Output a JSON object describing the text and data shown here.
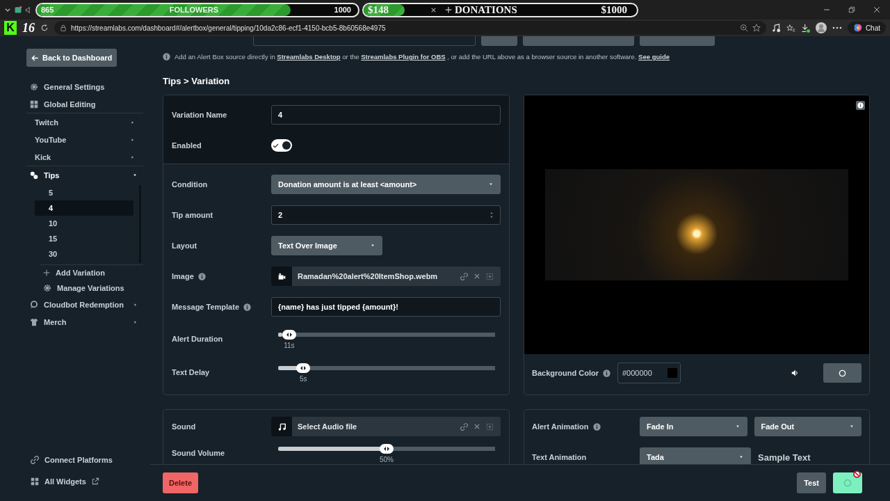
{
  "overlay": {
    "followers": {
      "current": "865",
      "label": "FOLLOWERS",
      "goal": "1000",
      "level": 0.79
    },
    "donations": {
      "current": "$148",
      "label": "DONATIONS",
      "goal": "$1000",
      "level": 0.15
    }
  },
  "browser": {
    "logo": "K",
    "badge": "16",
    "url": "https://streamlabs.com/dashboard#/alertbox/general/tipping/10da2c86-ecf1-4150-bcb5-8b60568e4975",
    "chat": "Chat"
  },
  "sidebar": {
    "back": "Back to Dashboard",
    "items": [
      {
        "kind": "nav",
        "label": "General Settings"
      },
      {
        "kind": "nav",
        "label": "Global Editing"
      },
      {
        "kind": "platform",
        "label": "Twitch",
        "expanded": false
      },
      {
        "kind": "platform",
        "label": "YouTube",
        "expanded": false
      },
      {
        "kind": "platform",
        "label": "Kick",
        "expanded": false
      },
      {
        "kind": "group",
        "label": "Tips",
        "expanded": true,
        "children": [
          {
            "label": "5",
            "selected": false
          },
          {
            "label": "4",
            "selected": true
          },
          {
            "label": "10",
            "selected": false
          },
          {
            "label": "15",
            "selected": false
          },
          {
            "label": "30",
            "selected": false
          }
        ],
        "actions": [
          "Add Variation",
          "Manage Variations"
        ]
      },
      {
        "kind": "group",
        "label": "Cloudbot Redemption",
        "expanded": false
      },
      {
        "kind": "group",
        "label": "Merch",
        "expanded": false
      }
    ],
    "footer_links": [
      {
        "label": "Connect Platforms",
        "external": false
      },
      {
        "label": "All Widgets",
        "external": true
      }
    ]
  },
  "info_line": [
    {
      "text": "Add an Alert Box source directly in",
      "link": false
    },
    {
      "text": "Streamlabs Desktop",
      "link": true
    },
    {
      "text": "or the",
      "link": false
    },
    {
      "text": "Streamlabs Plugin for OBS",
      "link": true
    },
    {
      "text": ", or add the URL above as a browser source in another software.",
      "link": false
    },
    {
      "text": "See guide",
      "link": true
    }
  ],
  "breadcrumb": "Tips > Variation",
  "variation_panel": {
    "header_rows": [
      {
        "kind": "text",
        "label": "Variation Name",
        "value": "4"
      },
      {
        "kind": "toggle",
        "label": "Enabled",
        "on": true
      }
    ],
    "rows": [
      {
        "kind": "select",
        "label": "Condition",
        "value": "Donation amount is at least <amount>"
      },
      {
        "kind": "number",
        "label": "Tip amount",
        "value": "2"
      },
      {
        "kind": "short-select",
        "label": "Layout",
        "value": "Text Over Image"
      },
      {
        "kind": "file",
        "label": "Image",
        "info": true,
        "value": "Ramadan%20alert%20ItemShop.webm"
      },
      {
        "kind": "text",
        "label": "Message Template",
        "info": true,
        "value": "{name} has just tipped {amount}!"
      },
      {
        "kind": "slider",
        "label": "Alert Duration",
        "level": 0.02,
        "reading": "11s"
      },
      {
        "kind": "slider",
        "label": "Text Delay",
        "level": 0.09,
        "reading": "5s"
      }
    ]
  },
  "sound_panel": {
    "rows": [
      {
        "kind": "file",
        "label": "Sound",
        "placeholder": "Select Audio file"
      },
      {
        "kind": "slider",
        "label": "Sound Volume",
        "level": 0.5,
        "reading": "50%"
      }
    ]
  },
  "preview": {
    "background_label": "Background Color",
    "background_value": "#000000",
    "muted": false
  },
  "animation_panel": {
    "alert_label": "Alert Animation",
    "alert_in": "Fade In",
    "alert_out": "Fade Out",
    "text_label": "Text Animation",
    "text_value": "Tada",
    "sample": "Sample Text"
  },
  "footer": {
    "delete": "Delete",
    "test": "Test",
    "saving": true
  }
}
